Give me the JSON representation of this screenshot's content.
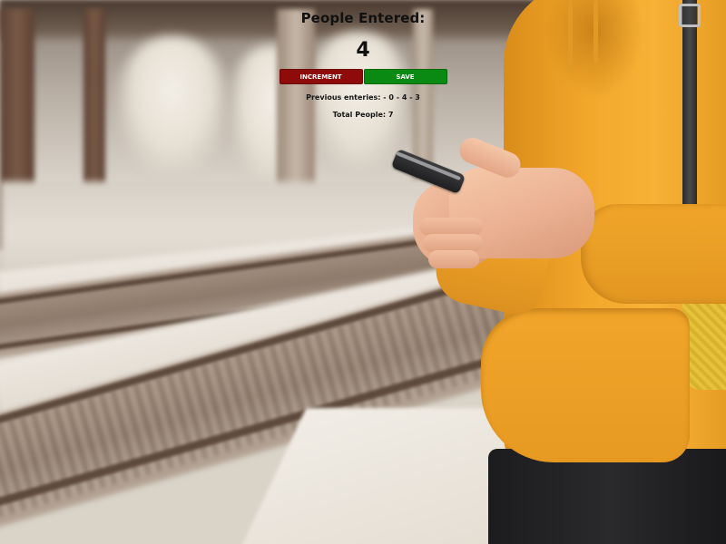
{
  "header": {
    "title": "People Entered:"
  },
  "counter": {
    "value": "4"
  },
  "buttons": {
    "increment_label": "INCREMENT",
    "save_label": "SAVE"
  },
  "summary": {
    "previous_entries_text": "Previous enteries: - 0 - 4 - 3",
    "total_people_text": "Total People: 7"
  },
  "colors": {
    "increment_button": "#8f0b0b",
    "save_button": "#0a8a12",
    "text": "#111111"
  }
}
